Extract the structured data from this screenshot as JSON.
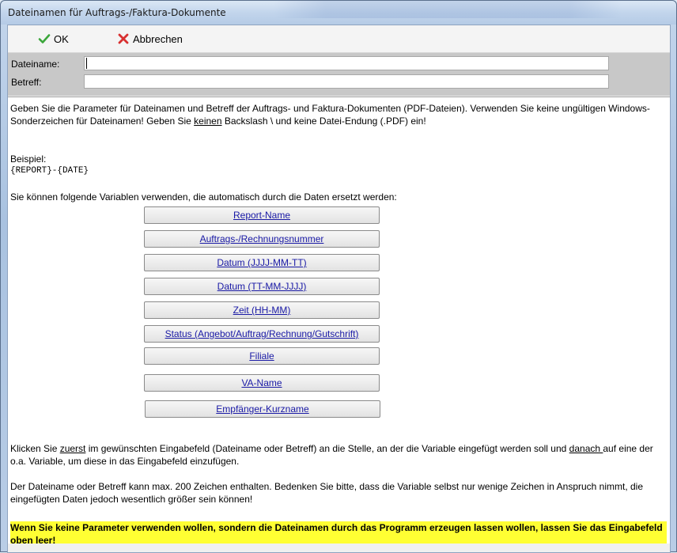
{
  "window": {
    "title": "Dateinamen für Auftrags-/Faktura-Dokumente"
  },
  "toolbar": {
    "ok_label": "OK",
    "cancel_label": "Abbrechen"
  },
  "form": {
    "filename_label": "Dateiname:",
    "filename_value": "",
    "subject_label": "Betreff:",
    "subject_value": ""
  },
  "content": {
    "intro_1": "Geben Sie die Parameter für Dateinamen und Betreff der Auftrags- und Faktura-Dokumenten (PDF-Dateien). Verwenden Sie keine ungültigen Windows-Sonderzeichen für Dateinamen! Geben Sie ",
    "intro_underline": "keinen",
    "intro_2": " Backslash \\ und keine Datei-Endung (.PDF) ein!",
    "example_label": "Beispiel:",
    "example_code": "{REPORT}-{DATE}",
    "variables_intro": "Sie können folgende Variablen verwenden, die automatisch durch die Daten ersetzt werden:",
    "variable_buttons": [
      "Report-Name",
      "Auftrags-/Rechnungsnummer",
      "Datum (JJJJ-MM-TT)",
      "Datum (TT-MM-JJJJ)",
      "Zeit (HH-MM)",
      "Status (Angebot/Auftrag/Rechnung/Gutschrift)",
      "Filiale",
      "VA-Name",
      "Empfänger-Kurzname"
    ],
    "click_1": "Klicken Sie ",
    "click_u1": "zuerst",
    "click_2": " im gewünschten Eingabefeld (Dateiname oder Betreff) an die Stelle, an der die Variable eingefügt werden soll und ",
    "click_u2": "danach ",
    "click_3": "auf eine der o.a. Variable, um diese in das Eingabefeld einzufügen.",
    "limit_text": "Der Dateiname oder Betreff kann max. 200 Zeichen enthalten. Bedenken Sie bitte, dass die Variable selbst nur wenige Zeichen in Anspruch nimmt, die eingefügten Daten jedoch wesentlich größer sein können!",
    "warning_text": "Wenn Sie keine Parameter verwenden wollen, sondern die Dateinamen durch das Programm erzeugen lassen wollen, lassen Sie das Eingabefeld oben leer!"
  },
  "colors": {
    "highlight": "#ffff33",
    "link": "#1a1aa6",
    "ok_check": "#3aa63a",
    "cancel_x": "#d83030"
  }
}
